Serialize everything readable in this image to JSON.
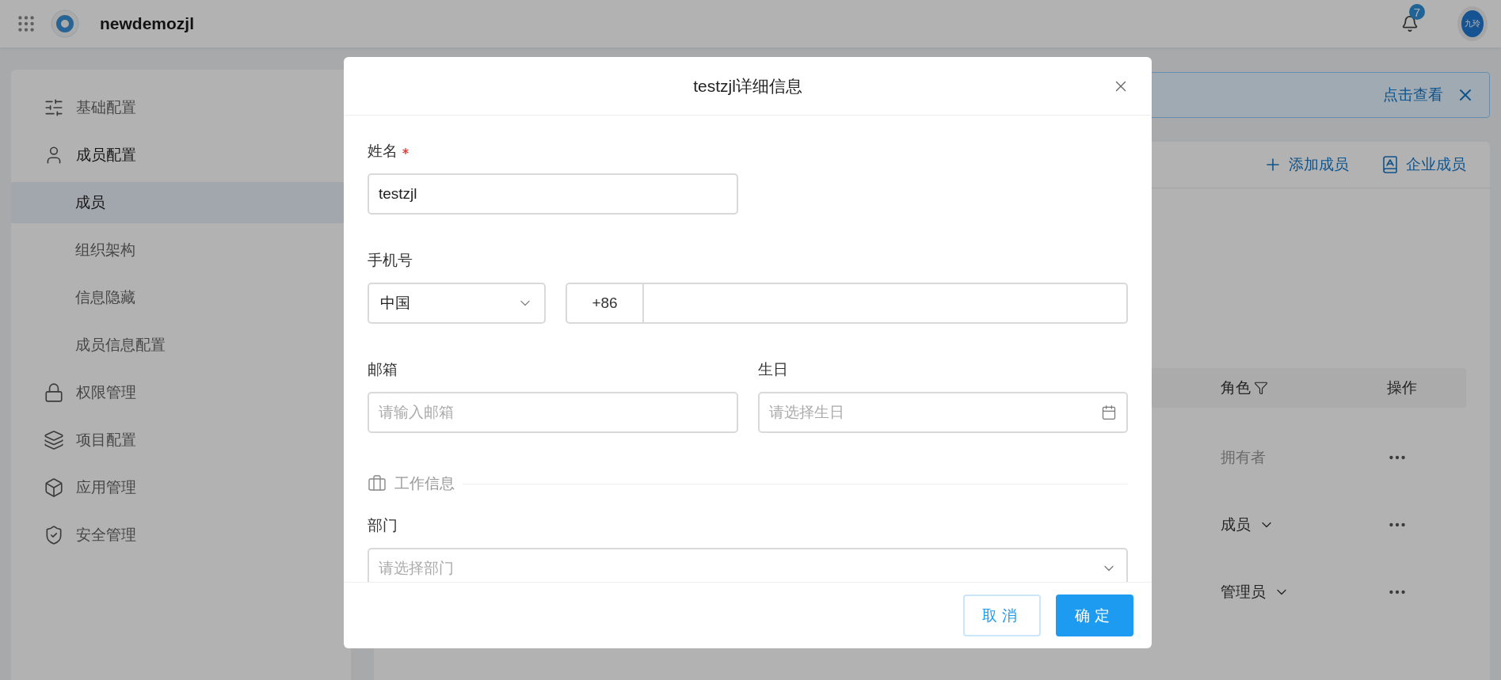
{
  "top_bar": {
    "app_name": "newdemozjl",
    "notification_count": "7",
    "avatar_text": "九玲"
  },
  "sidebar": {
    "items": [
      {
        "label": "基础配置",
        "expanded": false
      },
      {
        "label": "成员配置",
        "expanded": true,
        "children": [
          {
            "label": "成员",
            "selected": true
          },
          {
            "label": "组织架构",
            "selected": false
          },
          {
            "label": "信息隐藏",
            "selected": false
          },
          {
            "label": "成员信息配置",
            "selected": false
          }
        ]
      },
      {
        "label": "权限管理",
        "expanded": false
      },
      {
        "label": "项目配置",
        "expanded": false
      },
      {
        "label": "应用管理",
        "expanded": false
      },
      {
        "label": "安全管理",
        "expanded": false
      }
    ]
  },
  "main": {
    "banner": {
      "link": "点击查看"
    },
    "actions": [
      "添加成员",
      "企业成员"
    ],
    "table": {
      "columns": [
        {
          "label": "角色",
          "kind": "filter"
        },
        {
          "label": "操作",
          "kind": "plain"
        }
      ],
      "rows": [
        {
          "role": "拥有者",
          "editable": false
        },
        {
          "role": "成员",
          "editable": true
        },
        {
          "role": "管理员",
          "editable": true
        }
      ]
    }
  },
  "modal": {
    "title": "testzjl详细信息",
    "name": {
      "label": "姓名",
      "required": true,
      "value": "testzjl"
    },
    "phone": {
      "label": "手机号",
      "country": "中国",
      "code": "+86"
    },
    "email": {
      "label": "邮箱",
      "placeholder": "请输入邮箱"
    },
    "birthday": {
      "label": "生日",
      "placeholder": "请选择生日"
    },
    "section": "工作信息",
    "department": {
      "label": "部门",
      "placeholder": "请选择部门"
    },
    "buttons": [
      {
        "label": "取消",
        "kind": "secondary"
      },
      {
        "label": "确定",
        "kind": "primary"
      }
    ]
  }
}
